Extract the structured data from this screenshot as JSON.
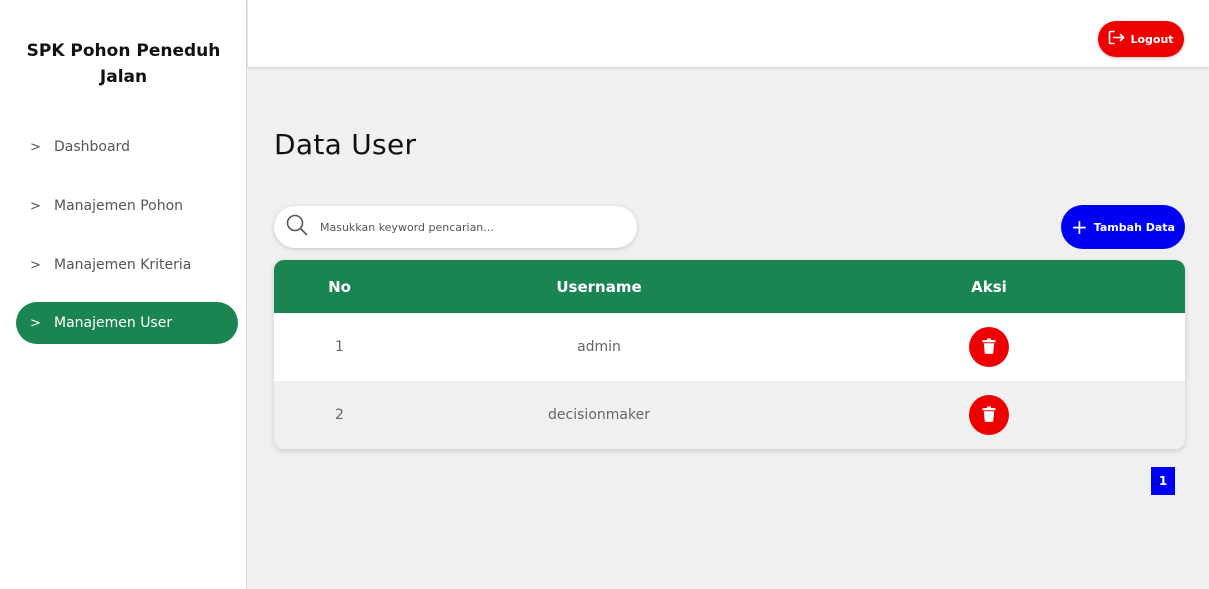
{
  "app": {
    "title_line1": "SPK Pohon Peneduh",
    "title_line2": "Jalan"
  },
  "sidebar": {
    "items": [
      {
        "label": "Dashboard",
        "active": false
      },
      {
        "label": "Manajemen Pohon",
        "active": false
      },
      {
        "label": "Manajemen Kriteria",
        "active": false
      },
      {
        "label": "Manajemen User",
        "active": true
      }
    ]
  },
  "topbar": {
    "logout_label": "Logout"
  },
  "main": {
    "title": "Data User",
    "search": {
      "placeholder": "Masukkan keyword pencarian...",
      "value": ""
    },
    "add_label": "Tambah Data",
    "table": {
      "columns": [
        "No",
        "Username",
        "Aksi"
      ],
      "rows": [
        {
          "no": "1",
          "username": "admin"
        },
        {
          "no": "2",
          "username": "decisionmaker"
        }
      ]
    },
    "pagination": {
      "current_page": "1"
    }
  },
  "colors": {
    "primary_green": "#1b8552",
    "accent_blue": "#0000f5",
    "danger_red": "#ee0000"
  }
}
